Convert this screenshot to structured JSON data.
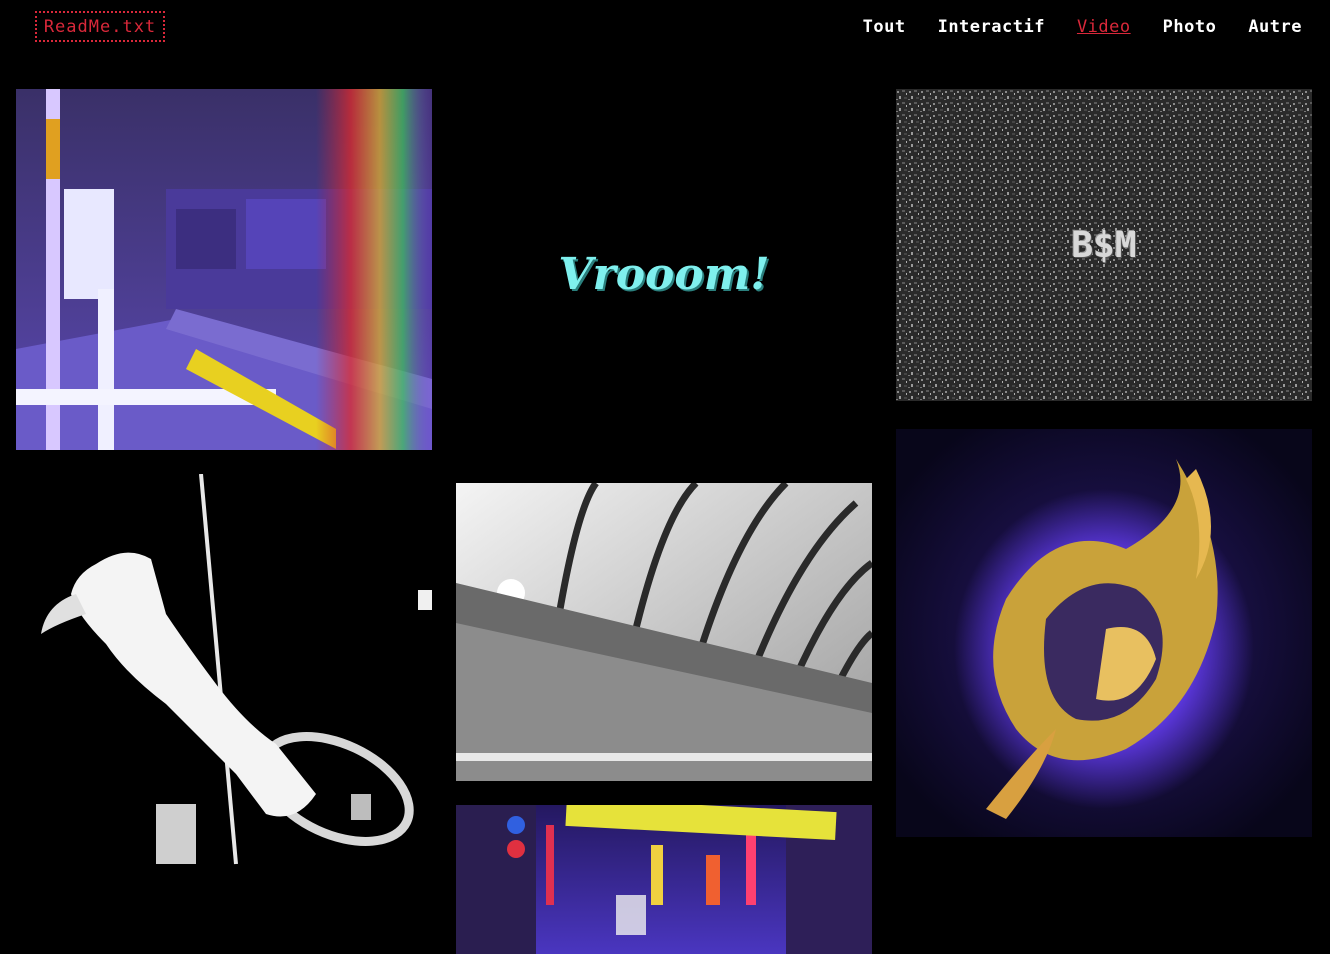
{
  "header": {
    "logo_label": "ReadMe.txt",
    "nav": [
      {
        "label": "Tout",
        "active": false
      },
      {
        "label": "Interactif",
        "active": false
      },
      {
        "label": "Video",
        "active": true
      },
      {
        "label": "Photo",
        "active": false
      },
      {
        "label": "Autre",
        "active": false
      }
    ]
  },
  "colors": {
    "background": "#000000",
    "accent": "#d9283a",
    "nav_text": "#ffffff"
  },
  "gallery": {
    "items": [
      {
        "title": "",
        "overlay_text": ""
      },
      {
        "title": "",
        "overlay_text": "Vrooom!"
      },
      {
        "title": "",
        "overlay_text": "B$M"
      },
      {
        "title": "",
        "overlay_text": ""
      },
      {
        "title": "",
        "overlay_text": ""
      },
      {
        "title": "",
        "overlay_text": ""
      },
      {
        "title": "",
        "overlay_text": ""
      }
    ]
  }
}
